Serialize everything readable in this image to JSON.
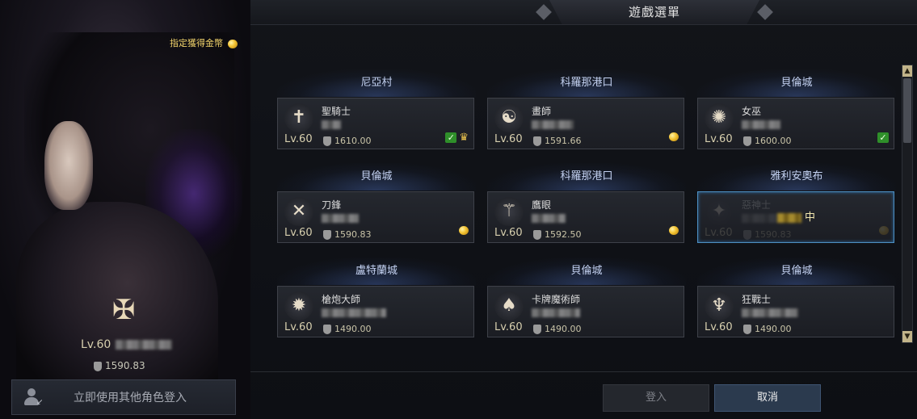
{
  "character": {
    "gold_hint": "指定獲得金幣",
    "level": "Lv.60",
    "item_level": "1590.83",
    "switch_login_label": "立即使用其他角色登入"
  },
  "menu": {
    "title": "遊戲選單",
    "login_label": "登入",
    "cancel_label": "取消",
    "scroll_up_icon": "triangle-up",
    "scroll_down_icon": "triangle-down"
  },
  "cards": [
    {
      "location": "尼亞村",
      "class_name": "聖騎士",
      "level": "Lv.60",
      "item_level": "1610.00",
      "badges": [
        "check",
        "crown"
      ],
      "icon": "paladin-icon"
    },
    {
      "location": "科羅那港口",
      "class_name": "畫師",
      "level": "Lv.60",
      "item_level": "1591.66",
      "badges": [
        "coin"
      ],
      "icon": "artist-icon"
    },
    {
      "location": "貝倫城",
      "class_name": "女巫",
      "level": "Lv.60",
      "item_level": "1600.00",
      "badges": [
        "check"
      ],
      "icon": "sorceress-icon"
    },
    {
      "location": "貝倫城",
      "class_name": "刀鋒",
      "level": "Lv.60",
      "item_level": "1590.83",
      "badges": [
        "coin"
      ],
      "icon": "deathblade-icon"
    },
    {
      "location": "科羅那港口",
      "class_name": "鷹眼",
      "level": "Lv.60",
      "item_level": "1592.50",
      "badges": [
        "coin"
      ],
      "icon": "sharpshooter-icon"
    },
    {
      "location": "雅利安奧布",
      "class_name": "惡神士",
      "level": "Lv.60",
      "item_level": "1590.83",
      "badges": [
        "coin"
      ],
      "icon": "class-icon",
      "status": "中"
    },
    {
      "location": "盧特蘭城",
      "class_name": "槍炮大師",
      "level": "Lv.60",
      "item_level": "1490.00",
      "badges": [],
      "icon": "gunslinger-icon"
    },
    {
      "location": "貝倫城",
      "class_name": "卡牌魔術師",
      "level": "Lv.60",
      "item_level": "1490.00",
      "badges": [],
      "icon": "arcanist-icon"
    },
    {
      "location": "貝倫城",
      "class_name": "狂戰士",
      "level": "Lv.60",
      "item_level": "1490.00",
      "badges": [],
      "icon": "berserker-icon"
    }
  ]
}
